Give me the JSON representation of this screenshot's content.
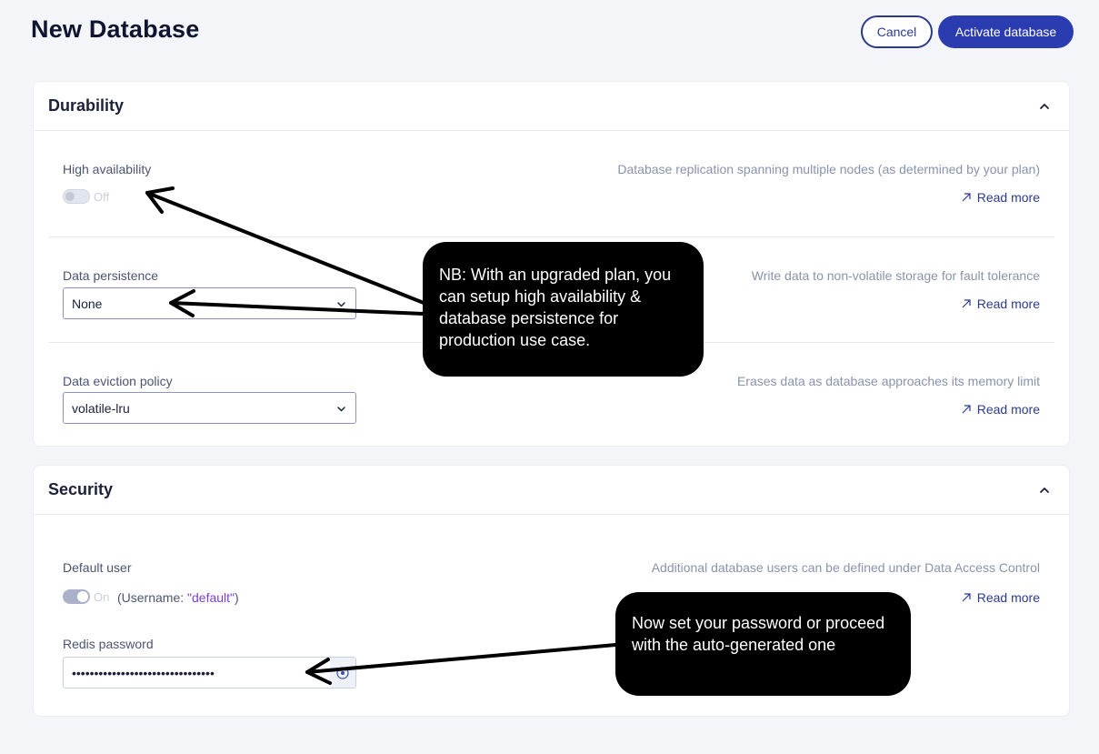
{
  "header": {
    "title": "New Database",
    "cancel_label": "Cancel",
    "activate_label": "Activate database"
  },
  "durability": {
    "title": "Durability",
    "high_availability": {
      "label": "High availability",
      "state": "Off",
      "description": "Database replication spanning multiple nodes (as determined by your plan)",
      "read_more": "Read more"
    },
    "data_persistence": {
      "label": "Data persistence",
      "value": "None",
      "description": "Write data to non-volatile storage for fault tolerance",
      "read_more": "Read more"
    },
    "data_eviction": {
      "label": "Data eviction policy",
      "value": "volatile-lru",
      "description": "Erases data as database approaches its memory limit",
      "read_more": "Read more"
    }
  },
  "security": {
    "title": "Security",
    "default_user": {
      "label": "Default user",
      "state": "On",
      "username_prefix": "(Username: ",
      "username_value": "\"default\"",
      "username_suffix": ")",
      "description": "Additional database users can be defined under Data Access Control",
      "read_more": "Read more"
    },
    "redis_password": {
      "label": "Redis password",
      "value": "••••••••••••••••••••••••••••••••"
    }
  },
  "callouts": {
    "upgrade_note": "NB: With an upgraded plan, you can setup high availability & database persistence for production use case.",
    "password_note": "Now set your password or proceed with the auto-generated one"
  },
  "colors": {
    "primary": "#2b3cb0",
    "accent_purple": "#7b3fd1",
    "background": "#f4f5f8"
  }
}
